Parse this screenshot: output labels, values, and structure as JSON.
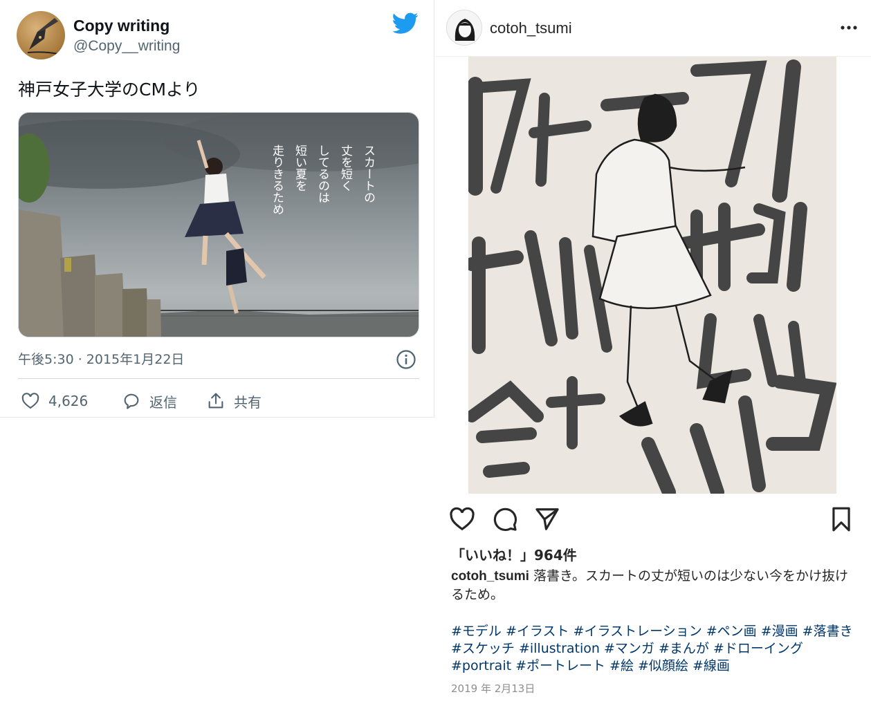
{
  "tweet": {
    "author_name": "Copy writing",
    "author_handle": "@Copy__writing",
    "text": "神戸女子大学のCMより",
    "media_text": [
      "スカートの",
      "丈を短く",
      "してるのは",
      "短い夏を",
      "走りきるため"
    ],
    "timestamp": "午後5:30 · 2015年1月22日",
    "like_count": "4,626",
    "reply_label": "返信",
    "share_label": "共有",
    "colors": {
      "brand": "#1d9bf0",
      "secondary_text": "#536471"
    },
    "icons": [
      "twitter-bird-icon",
      "info-icon",
      "heart-icon",
      "reply-icon",
      "share-icon"
    ]
  },
  "instagram": {
    "username": "cotoh_tsumi",
    "likes": "「いいね！」964件",
    "caption_user": "cotoh_tsumi",
    "caption_text": "落書き。スカートの丈が短いのは少ない今をかけ抜けるため。",
    "hashtags": "#モデル #イラスト #イラストレーション #ペン画 #漫画 #落書き #スケッチ #illustration #マンガ #まんが #ドローイング #portrait #ポートレート #絵 #似顔絵 #線画",
    "date": "2019 年 2月13日",
    "colors": {
      "hashtag": "#00376b",
      "date": "#8e8e8e"
    },
    "icons": [
      "more-icon",
      "heart-icon",
      "comment-icon",
      "send-icon",
      "bookmark-icon"
    ]
  }
}
